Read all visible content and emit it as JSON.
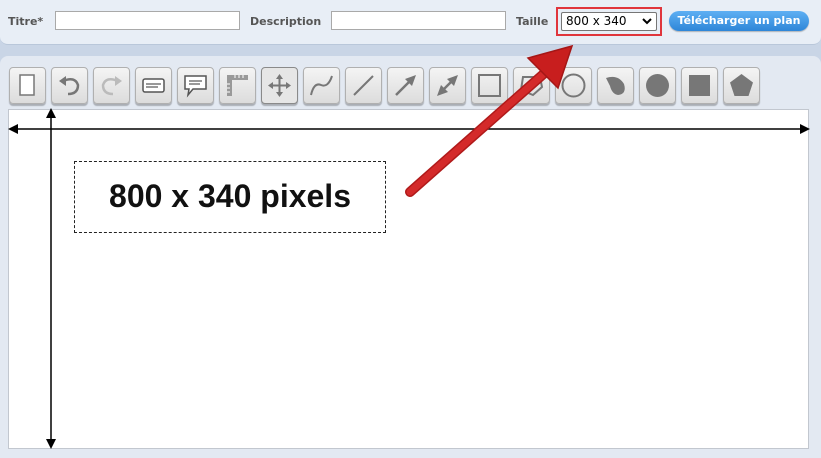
{
  "form": {
    "title_label": "Titre*",
    "title_value": "",
    "description_label": "Description",
    "description_value": "",
    "size_label": "Taille",
    "size_selected": "800 x 340",
    "download_label": "Télécharger un plan"
  },
  "toolbar": {
    "tools": [
      {
        "name": "new-page-tool",
        "icon": "page-icon"
      },
      {
        "name": "undo-tool",
        "icon": "undo-icon"
      },
      {
        "name": "redo-tool",
        "icon": "redo-icon"
      },
      {
        "name": "text-tool",
        "icon": "text-box-icon"
      },
      {
        "name": "speech-bubble-tool",
        "icon": "speech-bubble-icon"
      },
      {
        "name": "ruler-tool",
        "icon": "ruler-icon"
      },
      {
        "name": "move-tool",
        "icon": "move-icon",
        "active": true
      },
      {
        "name": "curve-tool",
        "icon": "curve-icon"
      },
      {
        "name": "line-tool",
        "icon": "line-icon"
      },
      {
        "name": "arrow-tool",
        "icon": "arrow-icon"
      },
      {
        "name": "double-arrow-tool",
        "icon": "double-arrow-icon"
      },
      {
        "name": "rectangle-tool",
        "icon": "rectangle-icon"
      },
      {
        "name": "polygon-outline-tool",
        "icon": "polygon-outline-icon"
      },
      {
        "name": "circle-tool",
        "icon": "circle-icon"
      },
      {
        "name": "freeform-fill-tool",
        "icon": "freeform-shape-icon"
      },
      {
        "name": "filled-circle-tool",
        "icon": "filled-circle-icon"
      },
      {
        "name": "filled-square-tool",
        "icon": "filled-square-icon"
      },
      {
        "name": "pentagon-tool",
        "icon": "pentagon-icon"
      }
    ]
  },
  "canvas": {
    "annotation_text": "800 x 340 pixels"
  },
  "colors": {
    "highlight": "#e0353c",
    "callout_arrow": "#c81e1e",
    "button": "#2e86d8"
  }
}
